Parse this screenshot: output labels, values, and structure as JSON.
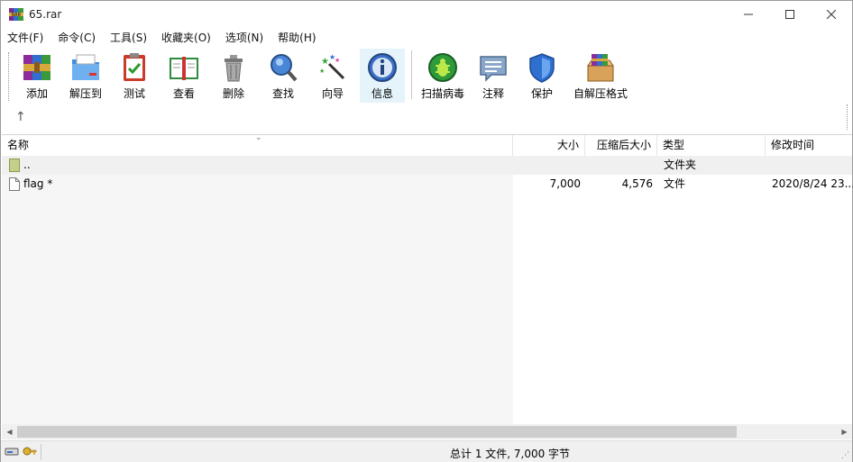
{
  "window": {
    "title": "65.rar"
  },
  "menu": [
    "文件(F)",
    "命令(C)",
    "工具(S)",
    "收藏夹(O)",
    "选项(N)",
    "帮助(H)"
  ],
  "toolbar": {
    "buttons": [
      {
        "label": "添加",
        "icon": "add-archive-icon"
      },
      {
        "label": "解压到",
        "icon": "extract-to-icon"
      },
      {
        "label": "测试",
        "icon": "test-icon"
      },
      {
        "label": "查看",
        "icon": "view-icon"
      },
      {
        "label": "删除",
        "icon": "delete-icon"
      },
      {
        "label": "查找",
        "icon": "find-icon"
      },
      {
        "label": "向导",
        "icon": "wizard-icon"
      },
      {
        "label": "信息",
        "icon": "info-icon"
      },
      {
        "label": "扫描病毒",
        "icon": "virus-scan-icon"
      },
      {
        "label": "注释",
        "icon": "comment-icon"
      },
      {
        "label": "保护",
        "icon": "protect-icon"
      },
      {
        "label": "自解压格式",
        "icon": "sfx-icon"
      }
    ],
    "up_arrow": "↑"
  },
  "columns": [
    "名称",
    "大小",
    "压缩后大小",
    "类型",
    "修改时间"
  ],
  "rows": [
    {
      "name": "..",
      "size": "",
      "packed": "",
      "type": "文件夹",
      "modified": ""
    },
    {
      "name": "flag *",
      "size": "7,000",
      "packed": "4,576",
      "type": "文件",
      "modified": "2020/8/24 23..."
    }
  ],
  "status": {
    "text": "总计 1 文件, 7,000 字节"
  },
  "colors": {
    "accent": "#0078d7",
    "selected_tool_bg": "#e5f3fb"
  }
}
